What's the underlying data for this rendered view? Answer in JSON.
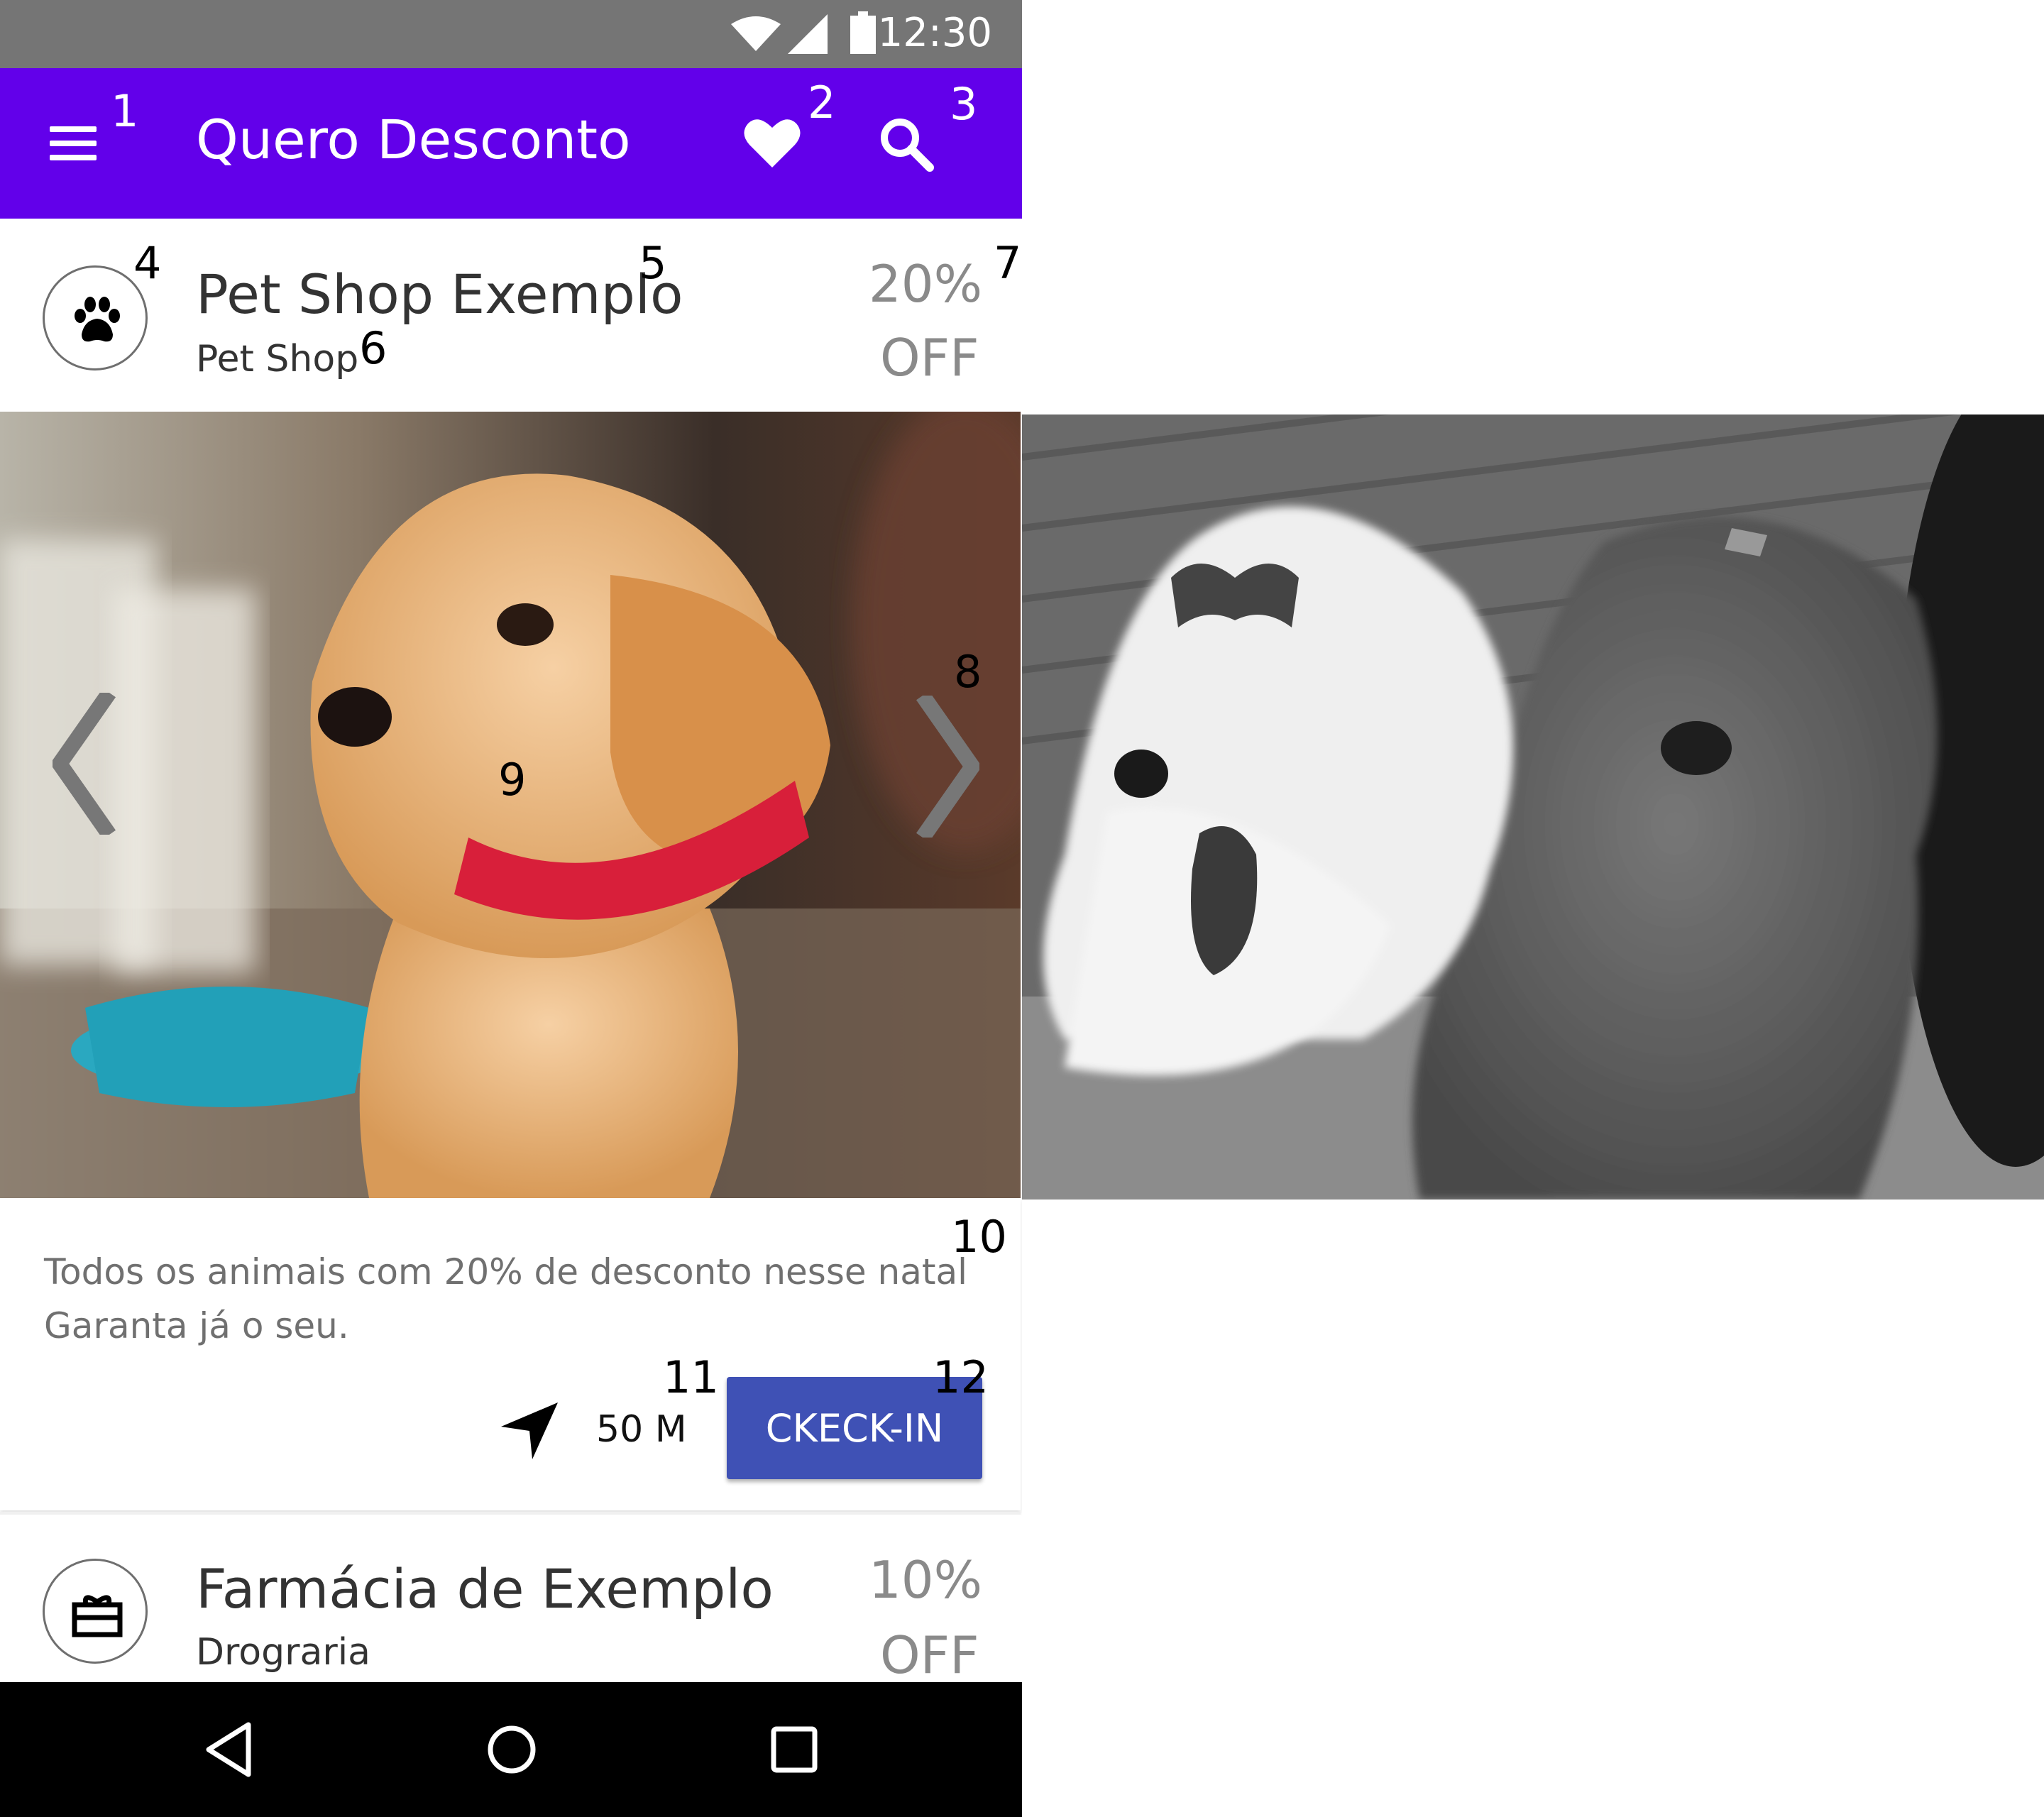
{
  "status_bar": {
    "time": "12:30",
    "icons": [
      "wifi-icon",
      "signal-icon",
      "battery-icon"
    ]
  },
  "app_bar": {
    "title": "Quero Desconto",
    "menu_icon": "menu-icon",
    "favorite_icon": "heart-icon",
    "search_icon": "search-icon",
    "background": "#6200ea"
  },
  "callouts": [
    "1",
    "2",
    "3",
    "4",
    "5",
    "6",
    "7",
    "8",
    "9",
    "10",
    "11",
    "12"
  ],
  "offers": [
    {
      "icon": "paw-icon",
      "name": "Pet Shop Exemplo",
      "category": "Pet Shop",
      "discount_percent": "20%",
      "discount_label": "OFF",
      "description_lines": [
        "Todos os animais com 20% de desconto nesse natal",
        "Garanta já o seu."
      ],
      "distance": "50 M",
      "distance_icon": "navigation-arrow-icon",
      "checkin_label": "CKECK-IN"
    },
    {
      "icon": "gift-icon",
      "name": "Farmácia de Exemplo",
      "category": "Drograria",
      "discount_percent": "10%",
      "discount_label": "OFF"
    }
  ],
  "carousel": {
    "prev_icon": "chevron-left-icon",
    "next_icon": "chevron-right-icon"
  },
  "nav_bar": {
    "icons": [
      "back-icon",
      "home-icon",
      "recents-icon"
    ]
  },
  "colors": {
    "status_bar": "#757575",
    "checkin_button": "#3f51b5",
    "discount_text": "#8a8a8a"
  }
}
